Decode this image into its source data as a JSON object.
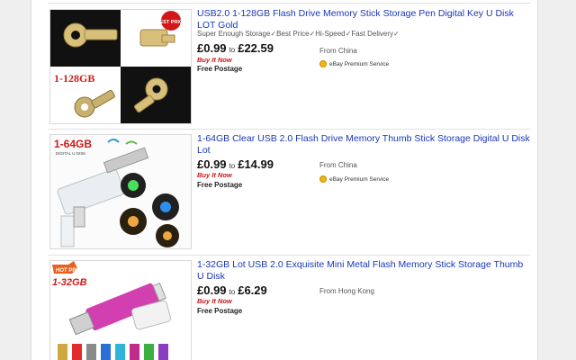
{
  "listings": [
    {
      "title": "USB2.0 1-128GB Flash Drive Memory Stick Storage Pen Digital Key U Disk LOT Gold",
      "subtitle": "Super Enough Storage✓Best Price✓Hi-Speed✓Fast Delivery✓",
      "price_low": "£0.99",
      "price_to": "to",
      "price_high": "£22.59",
      "buy_it_now": "Buy It Now",
      "postage": "Free Postage",
      "location": "From China",
      "premium": "eBay Premium Service",
      "thumb": {
        "badge": "1-128GB",
        "corner": "BEST PRICE"
      }
    },
    {
      "title": "1-64GB Clear USB 2.0 Flash Drive Memory Thumb Stick Storage Digital U Disk Lot",
      "subtitle": "",
      "price_low": "£0.99",
      "price_to": "to",
      "price_high": "£14.99",
      "buy_it_now": "Buy It Now",
      "postage": "Free Postage",
      "location": "From China",
      "premium": "eBay Premium Service",
      "thumb": {
        "badge": "1-64GB",
        "caption": "DIGITAL U DISK"
      }
    },
    {
      "title": "1-32GB Lot USB 2.0 Exquisite Mini Metal Flash Memory Stick Storage Thumb U Disk",
      "subtitle": "",
      "price_low": "£0.99",
      "price_to": "to",
      "price_high": "£6.29",
      "buy_it_now": "Buy It Now",
      "postage": "Free Postage",
      "location": "From Hong Kong",
      "premium": "",
      "thumb": {
        "badge": "1-32GB",
        "corner": "HOT PRICE"
      }
    }
  ]
}
